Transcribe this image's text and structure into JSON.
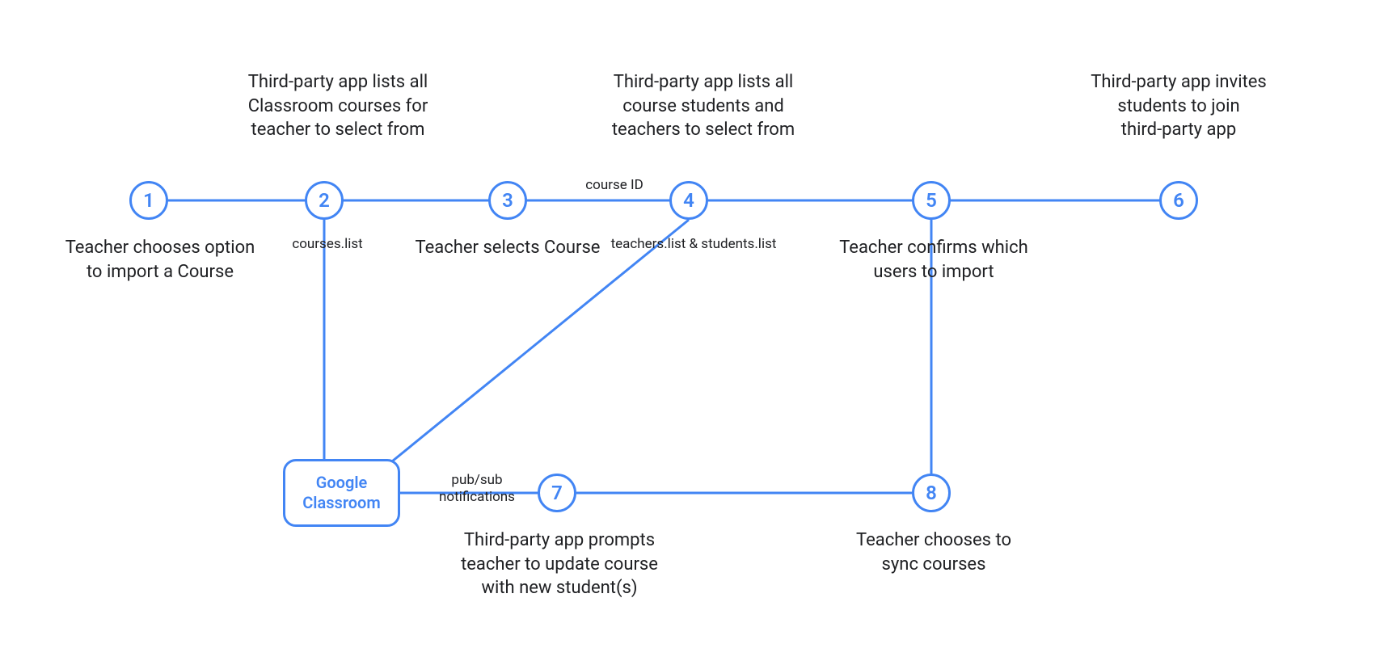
{
  "nodes": {
    "n1": {
      "num": "1",
      "labelBelow": "Teacher chooses option\nto import a Course"
    },
    "n2": {
      "num": "2",
      "labelAbove": "Third-party app lists all\nClassroom courses for\nteacher to select from",
      "apiBelow": "courses.list"
    },
    "n3": {
      "num": "3",
      "labelBelow": "Teacher selects Course"
    },
    "n4": {
      "num": "4",
      "labelAbove": "Third-party app lists all\ncourse students and\nteachers to select from",
      "apiBelow": "teachers.list &  students.list"
    },
    "n5": {
      "num": "5",
      "labelBelow": "Teacher confirms which\nusers to import"
    },
    "n6": {
      "num": "6",
      "labelAbove": "Third-party app invites\nstudents to join\nthird-party app"
    },
    "n7": {
      "num": "7",
      "labelBelow": "Third-party app prompts\nteacher to update course\nwith new student(s)"
    },
    "n8": {
      "num": "8",
      "labelBelow": "Teacher chooses to\nsync courses"
    },
    "gc": {
      "text": "Google\nClassroom"
    }
  },
  "edgeLabels": {
    "courseId": "course ID",
    "pubsub": "pub/sub\nnotifications"
  },
  "colors": {
    "accent": "#4285f4",
    "text": "#202124"
  }
}
